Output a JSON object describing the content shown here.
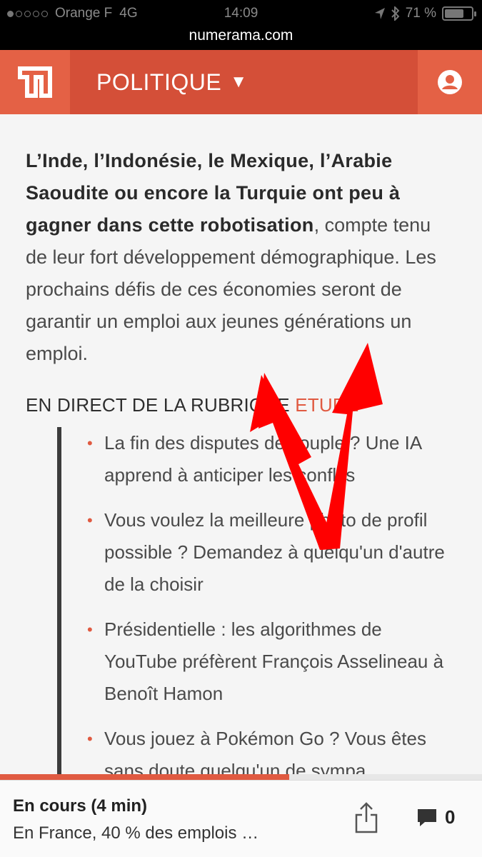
{
  "status_bar": {
    "carrier": "Orange F",
    "network": "4G",
    "time": "14:09",
    "battery": "71 %",
    "battery_level": 0.71
  },
  "browser": {
    "url": "numerama.com"
  },
  "header": {
    "section": "POLITIQUE",
    "logo_icon": "numerama-logo-icon",
    "account_icon": "account-icon",
    "accent_color": "#e05a41"
  },
  "article": {
    "lead_bold": "L’Inde, l’Indonésie, le Mexique, l’Arabie Saoudite ou encore la Turquie ont peu à gagner dans cette robotisation",
    "lead_rest": ", compte tenu de leur fort développement démographique. Les prochains défis de ces économies seront de garantir un emploi aux jeunes générations un emploi."
  },
  "rubric": {
    "prefix": "EN DIRECT DE LA RUBRIQUE ",
    "name": "ETUDE"
  },
  "related": [
    "La fin des disputes de couple ? Une IA apprend à anticiper les conflits",
    "Vous voulez la meilleure photo de profil possible ? Demandez à quelqu'un d'autre de la choisir",
    "Présidentielle : les algorithmes de YouTube préfèrent François Asselineau à Benoît Hamon",
    "Vous jouez à Pokémon Go ? Vous êtes sans doute quelqu'un de sympa"
  ],
  "reading_bar": {
    "title": "En cours (4 min)",
    "subtitle": "En France, 40 % des emplois …",
    "progress": 0.6,
    "comments": "0"
  }
}
